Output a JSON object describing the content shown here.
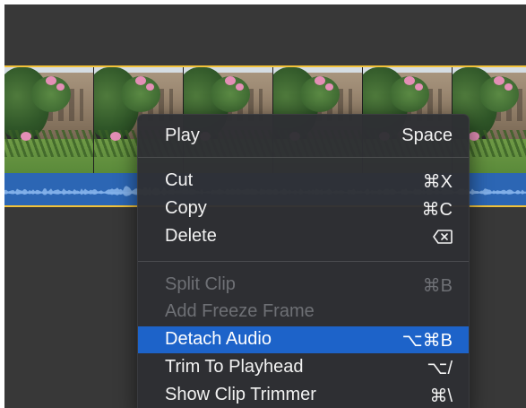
{
  "menu": {
    "play": {
      "label": "Play",
      "shortcut": "Space"
    },
    "cut": {
      "label": "Cut",
      "shortcut": "⌘X"
    },
    "copy": {
      "label": "Copy",
      "shortcut": "⌘C"
    },
    "delete": {
      "label": "Delete",
      "shortcut_icon": "delete-backward-icon"
    },
    "split_clip": {
      "label": "Split Clip",
      "shortcut": "⌘B",
      "enabled": false
    },
    "add_freeze_frame": {
      "label": "Add Freeze Frame",
      "enabled": false
    },
    "detach_audio": {
      "label": "Detach Audio",
      "shortcut": "⌥⌘B",
      "selected": true
    },
    "trim_to_playhead": {
      "label": "Trim To Playhead",
      "shortcut": "⌥/"
    },
    "show_clip_trimmer": {
      "label": "Show Clip Trimmer",
      "shortcut": "⌘\\"
    }
  },
  "colors": {
    "selection": "#1d63c9",
    "clip_border": "#f2c23a",
    "audio_track": "#2c66b4",
    "background": "#383838"
  }
}
